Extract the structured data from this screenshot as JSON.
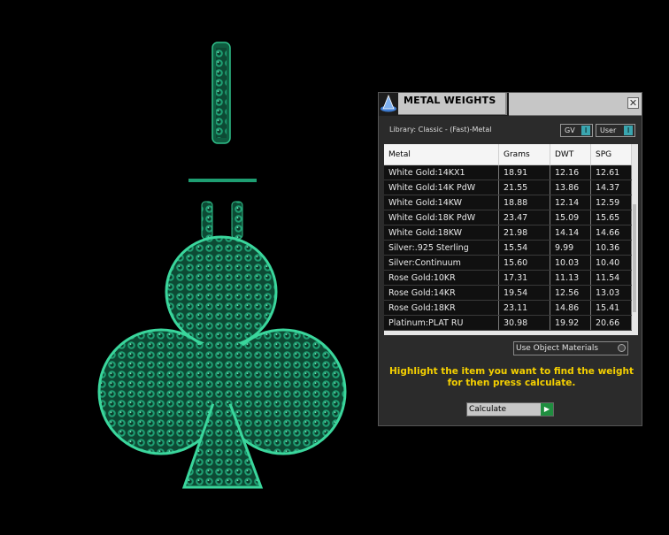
{
  "panel": {
    "title": "METAL WEIGHTS",
    "close_glyph": "✕",
    "library_label": "Library: Classic - (Fast)-Metal",
    "toggles": [
      {
        "label": "GV",
        "knob": "I"
      },
      {
        "label": "User",
        "knob": "I"
      }
    ],
    "table": {
      "headers": [
        "Metal",
        "Grams",
        "DWT",
        "SPG"
      ],
      "rows": [
        [
          "White Gold:14KX1",
          "18.91",
          "12.16",
          "12.61"
        ],
        [
          "White Gold:14K PdW",
          "21.55",
          "13.86",
          "14.37"
        ],
        [
          "White Gold:14KW",
          "18.88",
          "12.14",
          "12.59"
        ],
        [
          "White Gold:18K PdW",
          "23.47",
          "15.09",
          "15.65"
        ],
        [
          "White Gold:18KW",
          "21.98",
          "14.14",
          "14.66"
        ],
        [
          "Silver:.925 Sterling",
          "15.54",
          "9.99",
          "10.36"
        ],
        [
          "Silver:Continuum",
          "15.60",
          "10.03",
          "10.40"
        ],
        [
          "Rose Gold:10KR",
          "17.31",
          "11.13",
          "11.54"
        ],
        [
          "Rose Gold:14KR",
          "19.54",
          "12.56",
          "13.03"
        ],
        [
          "Rose Gold:18KR",
          "23.11",
          "14.86",
          "15.41"
        ],
        [
          "Platinum:PLAT RU",
          "30.98",
          "19.92",
          "20.66"
        ]
      ]
    },
    "use_object_materials": "Use Object Materials",
    "hint": "Highlight the item you want to find the weight for then press calculate.",
    "calculate_label": "Calculate",
    "calculate_glyph": "▶"
  },
  "icons": {
    "logo": "app-logo-icon",
    "close": "close-icon",
    "calculate": "play-arrow-icon"
  },
  "colors": {
    "accent_green": "#1f8e3f",
    "hint_yellow": "#f5d000",
    "toggle_teal": "#3aa6b0",
    "pendant_green": "#1e9e72"
  }
}
